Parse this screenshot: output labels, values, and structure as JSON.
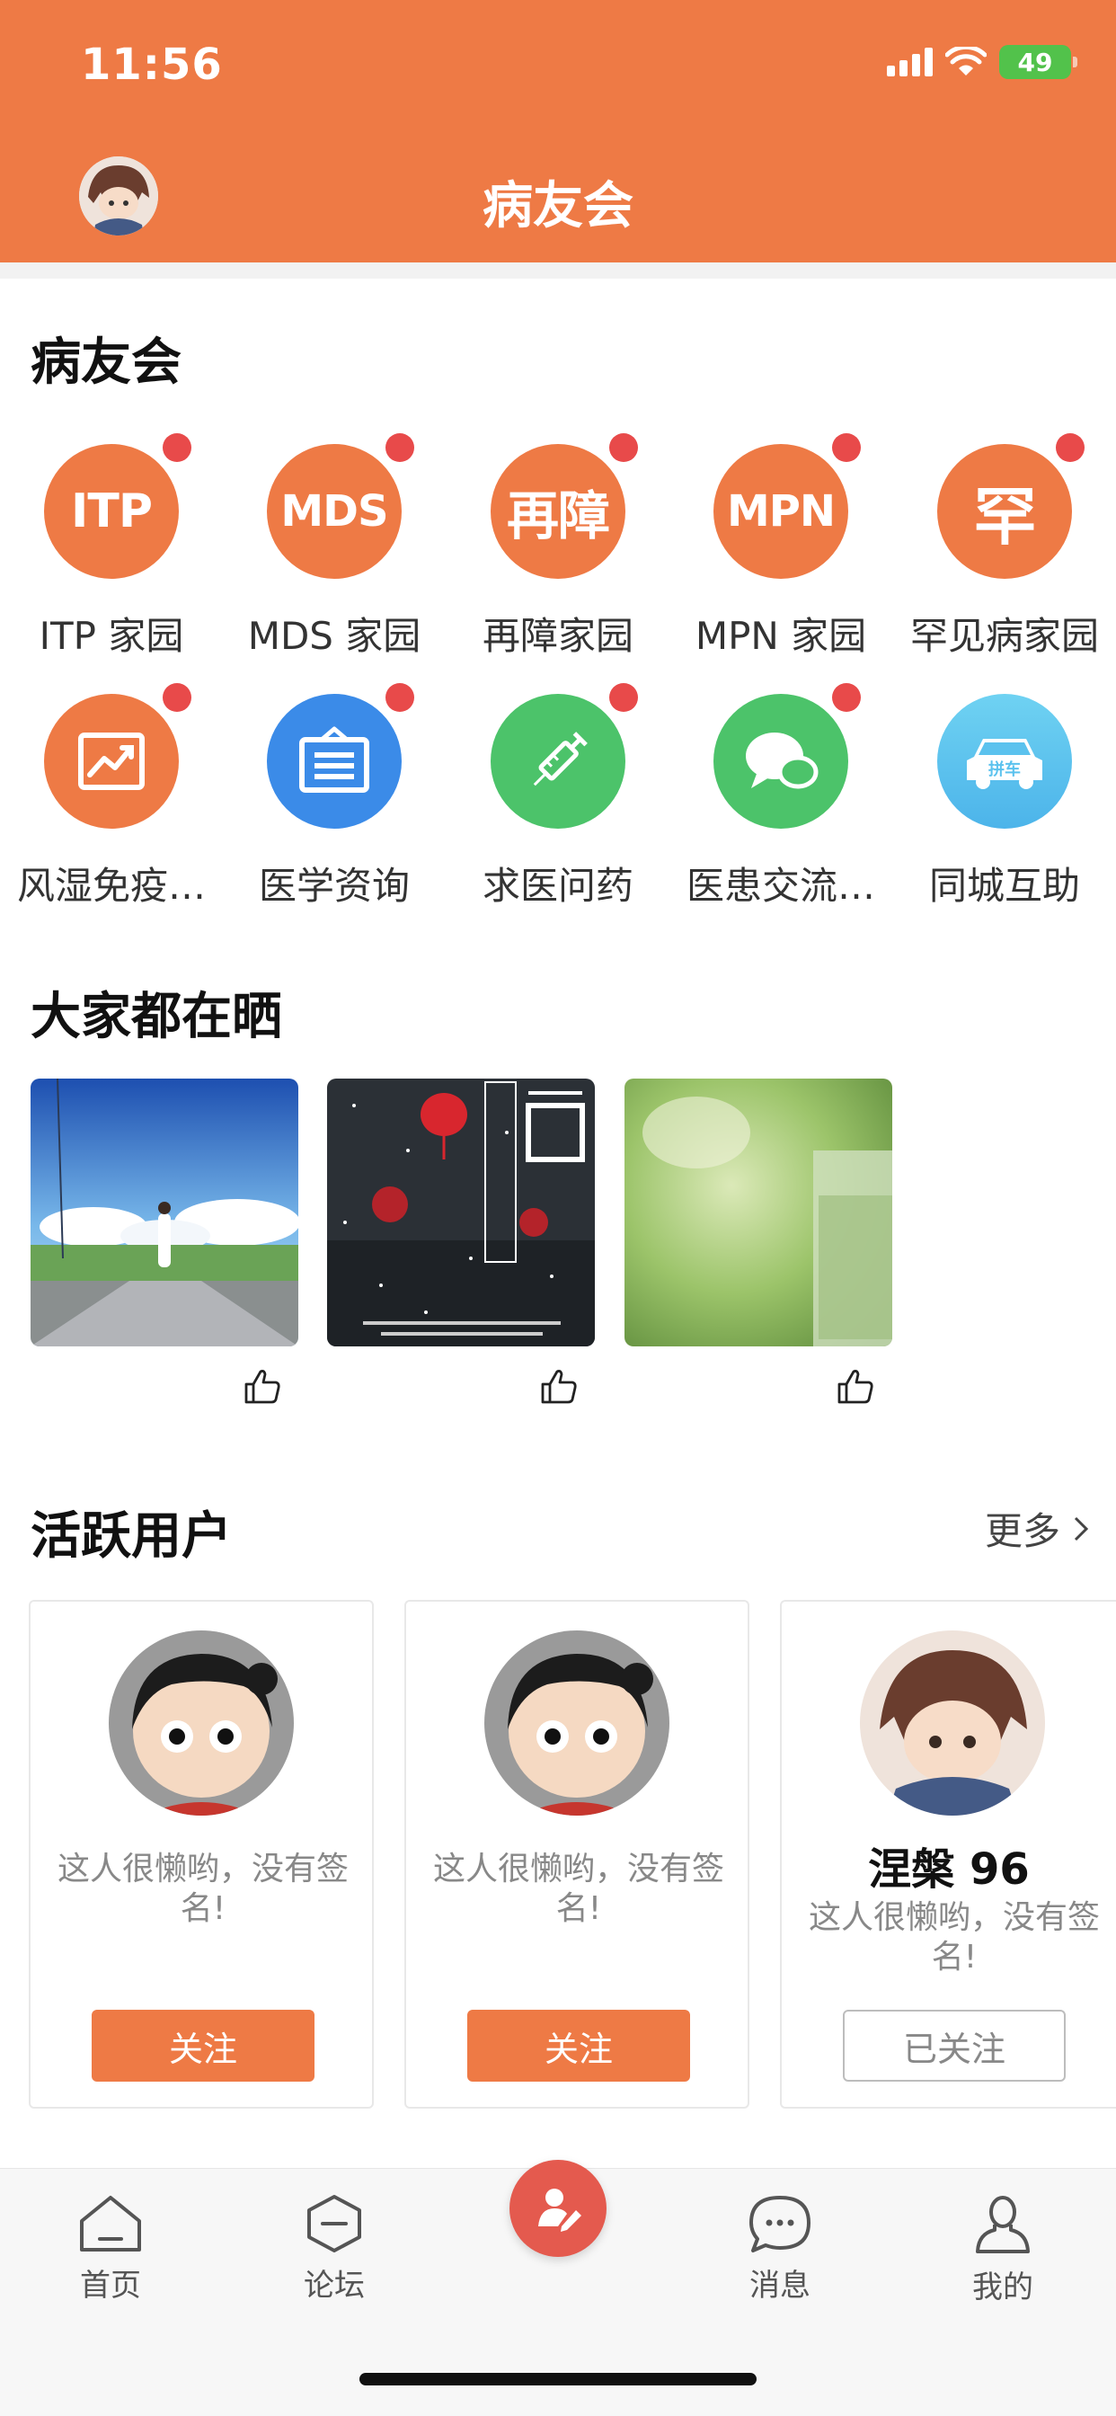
{
  "status_bar": {
    "time": "11:56",
    "battery": "49"
  },
  "header": {
    "title": "病友会"
  },
  "community": {
    "title": "病友会",
    "items": [
      {
        "icon": "ITP",
        "label": "ITP 家园",
        "color": "#EE7A45",
        "badge": true
      },
      {
        "icon": "MDS",
        "label": "MDS 家园",
        "color": "#EE7A45",
        "badge": true
      },
      {
        "icon": "再障",
        "label": "再障家园",
        "color": "#EE7A45",
        "badge": true
      },
      {
        "icon": "MPN",
        "label": "MPN 家园",
        "color": "#EE7A45",
        "badge": true
      },
      {
        "icon": "罕",
        "label": "罕见病家园",
        "color": "#EE7A45",
        "badge": true
      },
      {
        "icon": "chart-icon",
        "label": "风湿免疫…",
        "color": "#EE7A45",
        "badge": true
      },
      {
        "icon": "board-icon",
        "label": "医学资询",
        "color": "#3B8BE8",
        "badge": true
      },
      {
        "icon": "syringe-icon",
        "label": "求医问药",
        "color": "#4CC36A",
        "badge": true
      },
      {
        "icon": "chat-icon",
        "label": "医患交流…",
        "color": "#4CC36A",
        "badge": true
      },
      {
        "icon": "car-icon",
        "car_label": "拼车",
        "label": "同城互助",
        "color": "#5BC2EE",
        "badge": false
      }
    ]
  },
  "showcase": {
    "title": "大家都在晒"
  },
  "active_users": {
    "title": "活跃用户",
    "more": "更多",
    "users": [
      {
        "name": "",
        "sign": "这人很懒哟，没有签名!",
        "button": "关注",
        "followed": false
      },
      {
        "name": "",
        "sign": "这人很懒哟，没有签名!",
        "button": "关注",
        "followed": false
      },
      {
        "name": "涅槃 96",
        "sign": "这人很懒哟，没有签名!",
        "button": "已关注",
        "followed": true
      }
    ]
  },
  "tabbar": {
    "tabs": [
      {
        "label": "首页",
        "icon": "home-icon"
      },
      {
        "label": "论坛",
        "icon": "forum-icon"
      },
      {
        "label": "",
        "icon": "post-icon"
      },
      {
        "label": "消息",
        "icon": "message-icon"
      },
      {
        "label": "我的",
        "icon": "profile-icon"
      }
    ]
  }
}
